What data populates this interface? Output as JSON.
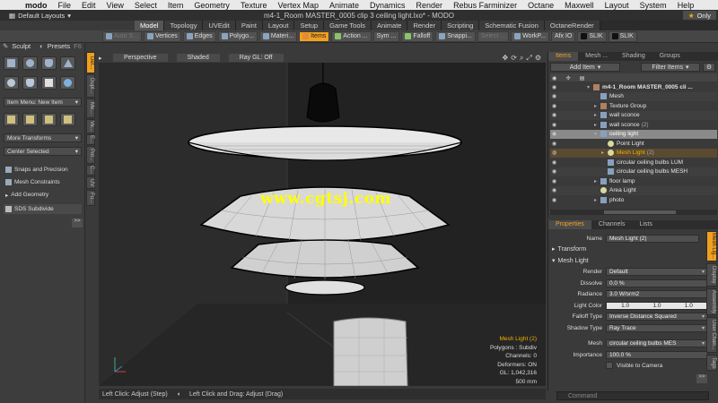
{
  "menubar": {
    "apple": "",
    "items": [
      "modo",
      "File",
      "Edit",
      "View",
      "Select",
      "Item",
      "Geometry",
      "Texture",
      "Vertex Map",
      "Animate",
      "Dynamics",
      "Render",
      "Rebus Farminizer",
      "Octane",
      "Maxwell",
      "Layout",
      "System",
      "Help"
    ]
  },
  "titlebar": {
    "layouts": "Default Layouts",
    "title": "m4-1_Room MASTER_0005 clip 3 ceiling light.lxo* - MODO",
    "only": "Only"
  },
  "tabs": [
    "Model",
    "Topology",
    "UVEdit",
    "Paint",
    "Layout",
    "Setup",
    "Game Tools",
    "Animate",
    "Render",
    "Scripting",
    "Schematic Fusion",
    "OctaneRender"
  ],
  "toolbar": {
    "buttons": [
      "Auto S...",
      "Vertices",
      "Edges",
      "Polygo...",
      "Materi...",
      "Items",
      "Action ...",
      "Sym ...",
      "Falloff",
      "Snappi...",
      "Select ...",
      "WorkP...",
      "Afx IO",
      "SLIK",
      "SLIK"
    ]
  },
  "leftpanel": {
    "sculpt": "Sculpt",
    "presets": "Presets",
    "presets_key": "F6",
    "item_menu": "Item Menu: New Item",
    "more_transforms": "More Transforms",
    "center_selected": "Center Selected",
    "snaps": "Snaps and Precision",
    "mesh_constraints": "Mesh Constraints",
    "add_geometry": "Add Geometry",
    "sds": "SDS Subdivide"
  },
  "lefttabs": [
    "Def...",
    "Dupl...",
    "Me...",
    "Ve...",
    "E...",
    "Pol...",
    "C...",
    "UV",
    "Fu..."
  ],
  "viewport": {
    "view": "Perspective",
    "shading": "Shaded",
    "raygl": "Ray GL: Off",
    "watermark": "www.cgtsj.com",
    "info": {
      "name": "Mesh Light (2)",
      "polygons": "Polygons : Subdiv",
      "channels": "Channels: 0",
      "deformers": "Deformers: ON",
      "gl": "GL: 1,042,316",
      "scale": "500 mm"
    }
  },
  "statusbar": {
    "left_click": "Left Click: Adjust (Step)",
    "left_drag": "Left Click and Drag: Adjust (Drag)"
  },
  "items": {
    "tabs": [
      "Items",
      "Mesh ...",
      "Shading",
      "Groups"
    ],
    "add_item": "Add Item",
    "filter_items": "Filter Items",
    "rows": [
      {
        "label": "m4-1_Room MASTER_0005 cli ...",
        "indent": 0,
        "type": "grp",
        "arrow": "▾",
        "suffix": ""
      },
      {
        "label": "Mesh",
        "indent": 1,
        "type": "mesh",
        "arrow": "",
        "suffix": ""
      },
      {
        "label": "Texture Group",
        "indent": 1,
        "type": "grp",
        "arrow": "▸",
        "suffix": ""
      },
      {
        "label": "wall sconce",
        "indent": 1,
        "type": "mesh",
        "arrow": "▸",
        "suffix": ""
      },
      {
        "label": "wall sconce",
        "indent": 1,
        "type": "mesh",
        "arrow": "▸",
        "suffix": "(2)"
      },
      {
        "label": "ceiling light",
        "indent": 1,
        "type": "mesh",
        "arrow": "▾",
        "suffix": ""
      },
      {
        "label": "Point Light",
        "indent": 2,
        "type": "light",
        "arrow": "",
        "suffix": ""
      },
      {
        "label": "Mesh Light",
        "indent": 2,
        "type": "light",
        "arrow": "▸",
        "suffix": "(2)"
      },
      {
        "label": "circular ceiling bulbs LUM",
        "indent": 2,
        "type": "mesh",
        "arrow": "",
        "suffix": ""
      },
      {
        "label": "circular ceiling bulbs MESH",
        "indent": 2,
        "type": "mesh",
        "arrow": "",
        "suffix": ""
      },
      {
        "label": "floor lamp",
        "indent": 1,
        "type": "mesh",
        "arrow": "▸",
        "suffix": ""
      },
      {
        "label": "Area Light",
        "indent": 1,
        "type": "light",
        "arrow": "",
        "suffix": ""
      },
      {
        "label": "photo",
        "indent": 1,
        "type": "mesh",
        "arrow": "▸",
        "suffix": ""
      }
    ]
  },
  "properties": {
    "tabs": [
      "Properties",
      "Channels",
      "Lists"
    ],
    "name_label": "Name",
    "name_value": "Mesh Light (2)",
    "transform": "Transform",
    "mesh_light": "Mesh Light",
    "render_label": "Render",
    "render_value": "Default",
    "dissolve_label": "Dissolve",
    "dissolve_value": "0.0 %",
    "radiance_label": "Radiance",
    "radiance_value": "3.0 W/srm2",
    "light_color_label": "Light Color",
    "light_color_values": [
      "1.0",
      "1.0",
      "1.0"
    ],
    "falloff_label": "Falloff Type",
    "falloff_value": "Inverse Distance Squared",
    "shadow_label": "Shadow Type",
    "shadow_value": "Ray Trace",
    "mesh_label": "Mesh",
    "mesh_value": "circular ceiling bulbs MES",
    "importance_label": "Importance",
    "importance_value": "100.0 %",
    "visible_to_camera": "Visible to Camera"
  },
  "righttabs": [
    "Mesh Lig...",
    "Display",
    "Assembly",
    "User Chan...",
    "Tags"
  ],
  "command": "Command",
  "colors": {
    "accent": "#f0a020",
    "highlight_text": "#f0b000",
    "watermark": "#ffff00"
  }
}
